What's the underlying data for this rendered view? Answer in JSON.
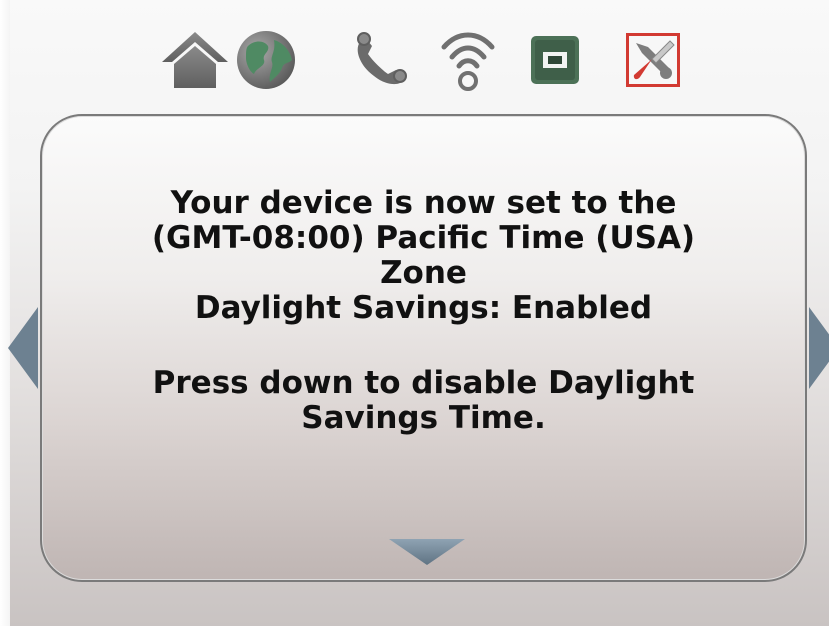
{
  "toolbar": {
    "icons": [
      {
        "name": "home-icon"
      },
      {
        "name": "globe-icon"
      },
      {
        "name": "phone-icon"
      },
      {
        "name": "wifi-icon"
      },
      {
        "name": "ethernet-port-icon"
      },
      {
        "name": "tools-icon",
        "selected": true
      }
    ]
  },
  "dialog": {
    "line1": "Your device is now set to the",
    "line2": "(GMT-08:00) Pacific Time (USA)",
    "line3": "Zone",
    "line4": "Daylight Savings: Enabled",
    "instruction_line1": "Press down to disable Daylight",
    "instruction_line2": "Savings Time."
  },
  "colors": {
    "icon_gray": "#6f6f6f",
    "icon_green": "#4a7d5c",
    "selected_border": "#d23a32",
    "arrow_blue": "#6d8191"
  }
}
